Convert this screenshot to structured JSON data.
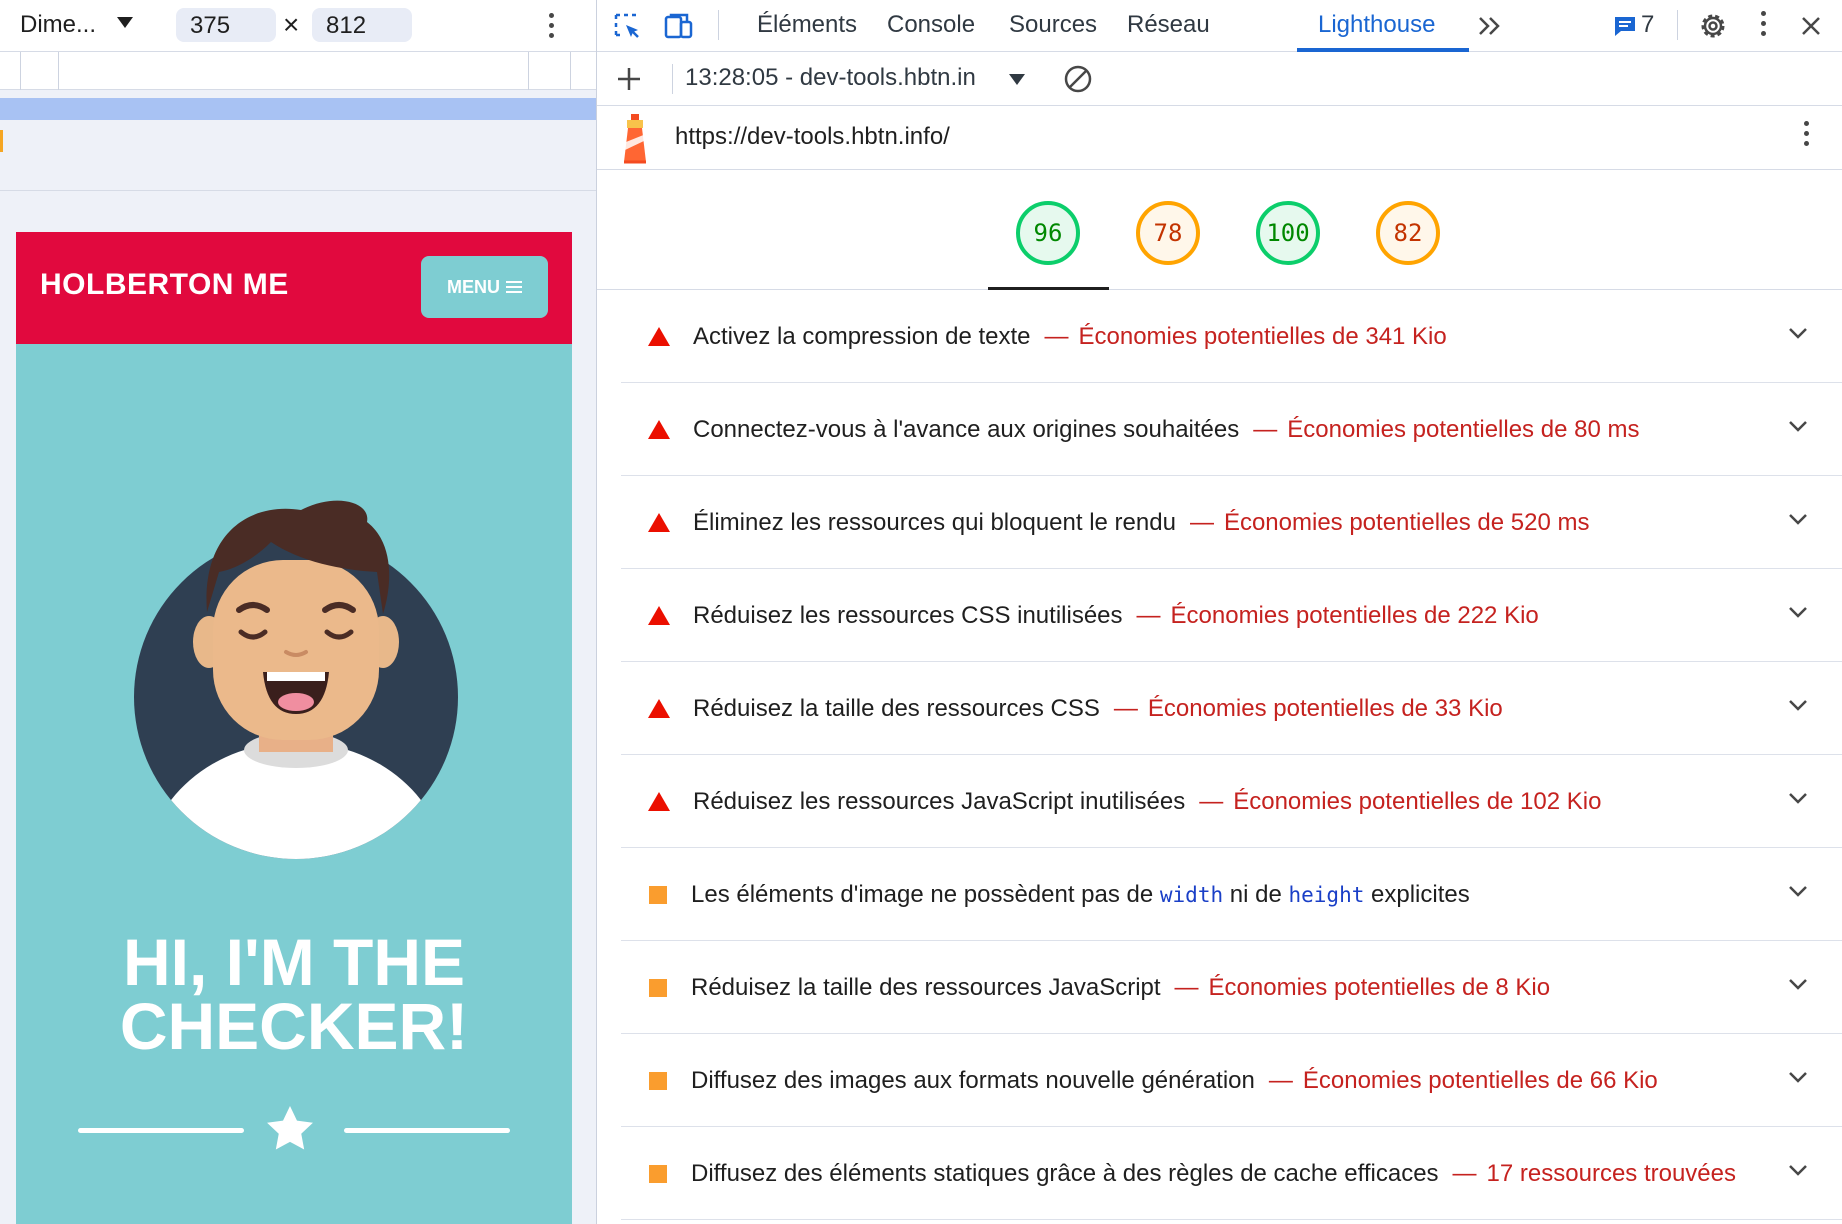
{
  "device_toolbar": {
    "dimensions_label": "Dime...",
    "width_value": "375",
    "height_value": "812",
    "times": "×"
  },
  "site": {
    "brand": "HOLBERTON ME",
    "menu_label": "MENU",
    "hero_title_line1": "HI, I'M THE",
    "hero_title_line2": "CHECKER!",
    "header_color": "#e1093e",
    "accent_color": "#7ecdd2"
  },
  "devtools": {
    "tabs": [
      "Éléments",
      "Console",
      "Sources",
      "Réseau",
      "Lighthouse"
    ],
    "active_tab": "Lighthouse",
    "issues_count": "7",
    "report_select": "13:28:05 - dev-tools.hbtn.in",
    "report_url": "https://dev-tools.hbtn.info/"
  },
  "scores": [
    {
      "value": "96",
      "color": "#0cce6b",
      "text_color": "#008800"
    },
    {
      "value": "78",
      "color": "#ffa400",
      "text_color": "#c33300"
    },
    {
      "value": "100",
      "color": "#0cce6b",
      "text_color": "#008800"
    },
    {
      "value": "82",
      "color": "#ffa400",
      "text_color": "#c33300"
    }
  ],
  "audits": [
    {
      "severity": "fail",
      "title": "Activez la compression de texte",
      "dash": "—",
      "saving": "Économies potentielles de 341 Kio"
    },
    {
      "severity": "fail",
      "title": "Connectez-vous à l'avance aux origines souhaitées",
      "dash": "—",
      "saving": "Économies potentielles de 80 ms"
    },
    {
      "severity": "fail",
      "title": "Éliminez les ressources qui bloquent le rendu",
      "dash": "—",
      "saving": "Économies potentielles de 520 ms"
    },
    {
      "severity": "fail",
      "title": "Réduisez les ressources CSS inutilisées",
      "dash": "—",
      "saving": "Économies potentielles de 222 Kio"
    },
    {
      "severity": "fail",
      "title": "Réduisez la taille des ressources CSS",
      "dash": "—",
      "saving": "Économies potentielles de 33 Kio"
    },
    {
      "severity": "fail",
      "title": "Réduisez les ressources JavaScript inutilisées",
      "dash": "—",
      "saving": "Économies potentielles de 102 Kio"
    },
    {
      "severity": "average",
      "title_parts": [
        "Les éléments d'image ne possèdent pas de ",
        "width",
        " ni de ",
        "height",
        " explicites"
      ]
    },
    {
      "severity": "average",
      "title": "Réduisez la taille des ressources JavaScript",
      "dash": "—",
      "saving": "Économies potentielles de 8 Kio"
    },
    {
      "severity": "average",
      "title": "Diffusez des images aux formats nouvelle génération",
      "dash": "—",
      "saving": "Économies potentielles de 66 Kio"
    },
    {
      "severity": "average",
      "title": "Diffusez des éléments statiques grâce à des règles de cache efficaces",
      "dash": "—",
      "saving": "17 ressources trouvées"
    }
  ],
  "icons": {
    "inspect": "inspect-element-icon",
    "device": "device-toolbar-icon",
    "more_tabs": "chevron-double-right-icon",
    "issues": "message-icon",
    "settings": "gear-icon",
    "kebab": "kebab-menu-icon",
    "close": "close-icon",
    "add": "plus-icon",
    "clear": "clear-icon",
    "lighthouse": "lighthouse-logo-icon",
    "expand": "chevron-down-icon"
  }
}
